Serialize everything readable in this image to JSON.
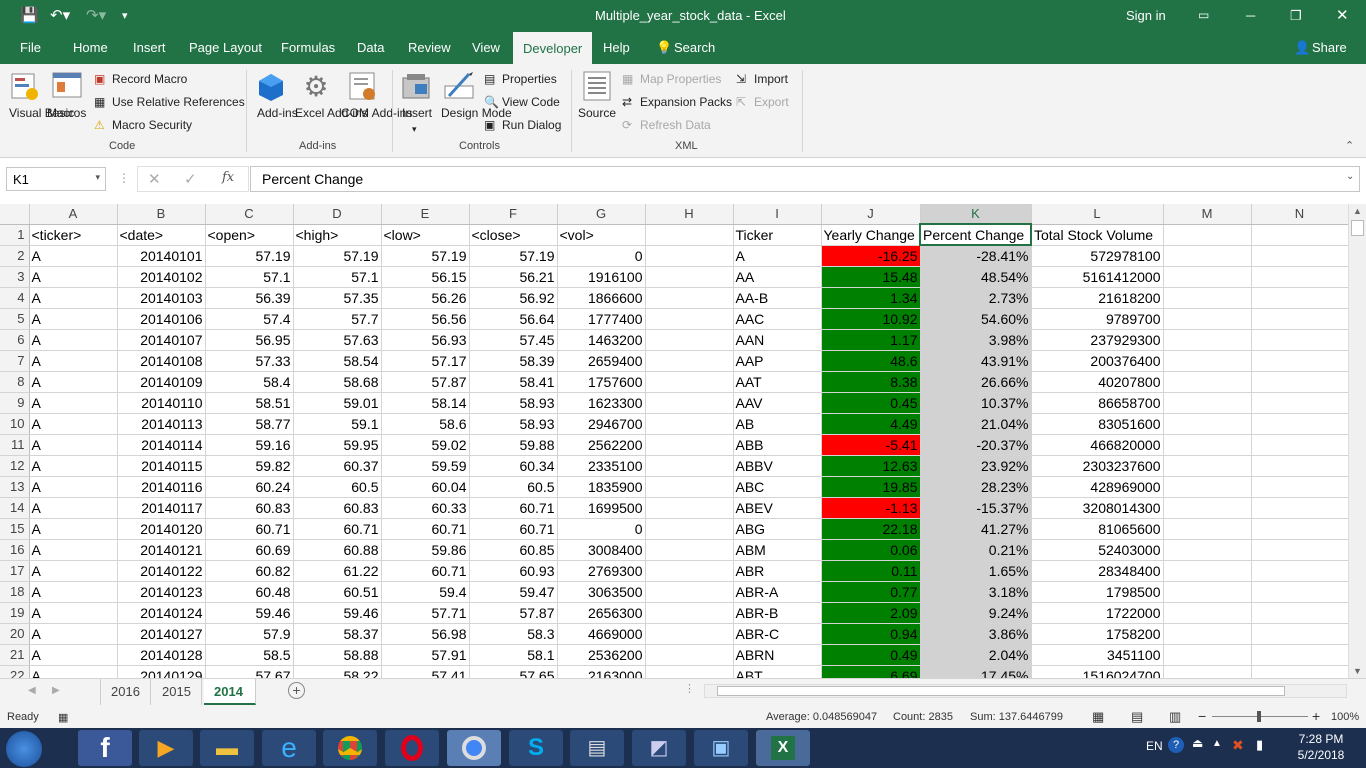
{
  "window": {
    "title": "Multiple_year_stock_data  -  Excel",
    "sign_in": "Sign in"
  },
  "ribbon_tabs": [
    "File",
    "Home",
    "Insert",
    "Page Layout",
    "Formulas",
    "Data",
    "Review",
    "View",
    "Developer",
    "Help"
  ],
  "search_label": "Search",
  "share_label": "Share",
  "ribbon": {
    "code": {
      "visual_basic": "Visual Basic",
      "macros": "Macros",
      "record_macro": "Record Macro",
      "relative_refs": "Use Relative References",
      "macro_security": "Macro Security",
      "group": "Code"
    },
    "addins": {
      "addins": "Add-ins",
      "excel_addins": "Excel Add-ins",
      "com_addins": "COM Add-ins",
      "group": "Add-ins"
    },
    "controls": {
      "insert": "Insert",
      "design_mode": "Design Mode",
      "properties": "Properties",
      "view_code": "View Code",
      "run_dialog": "Run Dialog",
      "group": "Controls"
    },
    "xml": {
      "source": "Source",
      "map_properties": "Map Properties",
      "expansion_packs": "Expansion Packs",
      "refresh_data": "Refresh Data",
      "import": "Import",
      "export": "Export",
      "group": "XML"
    }
  },
  "formula_bar": {
    "name_box": "K1",
    "fx": "fx",
    "content": "Percent Change"
  },
  "columns": [
    "A",
    "B",
    "C",
    "D",
    "E",
    "F",
    "G",
    "H",
    "I",
    "J",
    "K",
    "L",
    "M",
    "N"
  ],
  "header_row": [
    "<ticker>",
    "<date>",
    "<open>",
    "<high>",
    "<low>",
    "<close>",
    "<vol>",
    "",
    "Ticker",
    "Yearly Change",
    "Percent Change",
    "Total Stock Volume"
  ],
  "rows": [
    [
      "2",
      "A",
      "20140101",
      "57.19",
      "57.19",
      "57.19",
      "57.19",
      "0",
      "A",
      "-16.25",
      "-28.41%",
      "572978100",
      "neg"
    ],
    [
      "3",
      "A",
      "20140102",
      "57.1",
      "57.1",
      "56.15",
      "56.21",
      "1916100",
      "AA",
      "15.48",
      "48.54%",
      "5161412000",
      "pos"
    ],
    [
      "4",
      "A",
      "20140103",
      "56.39",
      "57.35",
      "56.26",
      "56.92",
      "1866600",
      "AA-B",
      "1.34",
      "2.73%",
      "21618200",
      "pos"
    ],
    [
      "5",
      "A",
      "20140106",
      "57.4",
      "57.7",
      "56.56",
      "56.64",
      "1777400",
      "AAC",
      "10.92",
      "54.60%",
      "9789700",
      "pos"
    ],
    [
      "6",
      "A",
      "20140107",
      "56.95",
      "57.63",
      "56.93",
      "57.45",
      "1463200",
      "AAN",
      "1.17",
      "3.98%",
      "237929300",
      "pos"
    ],
    [
      "7",
      "A",
      "20140108",
      "57.33",
      "58.54",
      "57.17",
      "58.39",
      "2659400",
      "AAP",
      "48.6",
      "43.91%",
      "200376400",
      "pos"
    ],
    [
      "8",
      "A",
      "20140109",
      "58.4",
      "58.68",
      "57.87",
      "58.41",
      "1757600",
      "AAT",
      "8.38",
      "26.66%",
      "40207800",
      "pos"
    ],
    [
      "9",
      "A",
      "20140110",
      "58.51",
      "59.01",
      "58.14",
      "58.93",
      "1623300",
      "AAV",
      "0.45",
      "10.37%",
      "86658700",
      "pos"
    ],
    [
      "10",
      "A",
      "20140113",
      "58.77",
      "59.1",
      "58.6",
      "58.93",
      "2946700",
      "AB",
      "4.49",
      "21.04%",
      "83051600",
      "pos"
    ],
    [
      "11",
      "A",
      "20140114",
      "59.16",
      "59.95",
      "59.02",
      "59.88",
      "2562200",
      "ABB",
      "-5.41",
      "-20.37%",
      "466820000",
      "neg"
    ],
    [
      "12",
      "A",
      "20140115",
      "59.82",
      "60.37",
      "59.59",
      "60.34",
      "2335100",
      "ABBV",
      "12.63",
      "23.92%",
      "2303237600",
      "pos"
    ],
    [
      "13",
      "A",
      "20140116",
      "60.24",
      "60.5",
      "60.04",
      "60.5",
      "1835900",
      "ABC",
      "19.85",
      "28.23%",
      "428969000",
      "pos"
    ],
    [
      "14",
      "A",
      "20140117",
      "60.83",
      "60.83",
      "60.33",
      "60.71",
      "1699500",
      "ABEV",
      "-1.13",
      "-15.37%",
      "3208014300",
      "neg"
    ],
    [
      "15",
      "A",
      "20140120",
      "60.71",
      "60.71",
      "60.71",
      "60.71",
      "0",
      "ABG",
      "22.18",
      "41.27%",
      "81065600",
      "pos"
    ],
    [
      "16",
      "A",
      "20140121",
      "60.69",
      "60.88",
      "59.86",
      "60.85",
      "3008400",
      "ABM",
      "0.06",
      "0.21%",
      "52403000",
      "pos"
    ],
    [
      "17",
      "A",
      "20140122",
      "60.82",
      "61.22",
      "60.71",
      "60.93",
      "2769300",
      "ABR",
      "0.11",
      "1.65%",
      "28348400",
      "pos"
    ],
    [
      "18",
      "A",
      "20140123",
      "60.48",
      "60.51",
      "59.4",
      "59.47",
      "3063500",
      "ABR-A",
      "0.77",
      "3.18%",
      "1798500",
      "pos"
    ],
    [
      "19",
      "A",
      "20140124",
      "59.46",
      "59.46",
      "57.71",
      "57.87",
      "2656300",
      "ABR-B",
      "2.09",
      "9.24%",
      "1722000",
      "pos"
    ],
    [
      "20",
      "A",
      "20140127",
      "57.9",
      "58.37",
      "56.98",
      "58.3",
      "4669000",
      "ABR-C",
      "0.94",
      "3.86%",
      "1758200",
      "pos"
    ],
    [
      "21",
      "A",
      "20140128",
      "58.5",
      "58.88",
      "57.91",
      "58.1",
      "2536200",
      "ABRN",
      "0.49",
      "2.04%",
      "3451100",
      "pos"
    ],
    [
      "22",
      "A",
      "20140129",
      "57.67",
      "58.22",
      "57.41",
      "57.65",
      "2163000",
      "ABT",
      "6.69",
      "17.45%",
      "1516024700",
      "pos"
    ]
  ],
  "sheet_tabs": [
    "2016",
    "2015",
    "2014"
  ],
  "active_sheet": "2014",
  "status": {
    "ready": "Ready",
    "average": "Average: 0.048569047",
    "count": "Count: 2835",
    "sum": "Sum: 137.6446799",
    "zoom": "100%"
  },
  "taskbar": {
    "lang": "EN",
    "time": "7:28 PM",
    "date": "5/2/2018"
  },
  "colors": {
    "excel_green": "#217346",
    "positive": "#008000",
    "negative": "#ff0000"
  }
}
